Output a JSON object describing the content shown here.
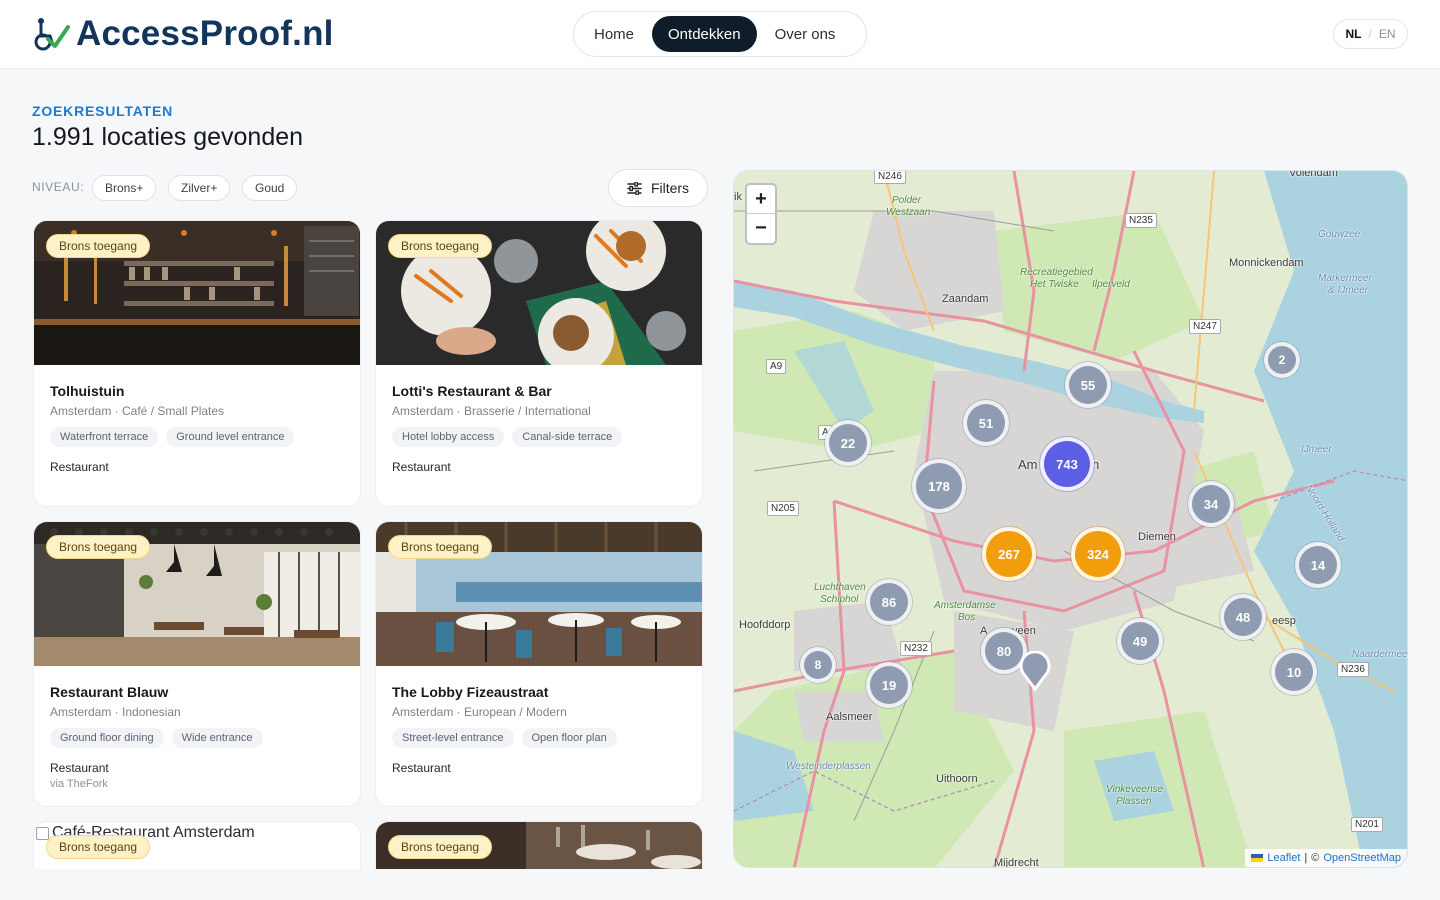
{
  "brand": {
    "name": "AccessProof.nl"
  },
  "nav": {
    "items": [
      "Home",
      "Ontdekken",
      "Over ons"
    ],
    "active": "Ontdekken"
  },
  "lang": {
    "active": "NL",
    "separator": "/",
    "other": "EN"
  },
  "results": {
    "eyebrow": "ZOEKRESULTATEN",
    "title": "1.991 locaties gevonden"
  },
  "filters": {
    "niveau_label": "NIVEAU:",
    "chips": [
      "Brons+",
      "Zilver+",
      "Goud"
    ],
    "button": "Filters"
  },
  "cards": [
    {
      "badge": "Brons toegang",
      "name": "Tolhuistuin",
      "meta": "Amsterdam · Café / Small Plates",
      "tags": [
        "Waterfront terrace",
        "Ground level entrance"
      ],
      "type": "Restaurant",
      "via": ""
    },
    {
      "badge": "Brons toegang",
      "name": "Lotti's Restaurant & Bar",
      "meta": "Amsterdam · Brasserie / International",
      "tags": [
        "Hotel lobby access",
        "Canal-side terrace"
      ],
      "type": "Restaurant",
      "via": ""
    },
    {
      "badge": "Brons toegang",
      "name": "Restaurant Blauw",
      "meta": "Amsterdam · Indonesian",
      "tags": [
        "Ground floor dining",
        "Wide entrance"
      ],
      "type": "Restaurant",
      "via": "via TheFork"
    },
    {
      "badge": "Brons toegang",
      "name": "The Lobby Fizeaustraat",
      "meta": "Amsterdam · European / Modern",
      "tags": [
        "Street-level entrance",
        "Open floor plan"
      ],
      "type": "Restaurant",
      "via": ""
    },
    {
      "badge": "Brons toegang",
      "alt": "Café-Restaurant Amsterdam"
    },
    {
      "badge": "Brons toegang"
    }
  ],
  "map": {
    "zoom_in": "+",
    "zoom_out": "−",
    "clusters": [
      "743",
      "324",
      "267",
      "178",
      "86",
      "80",
      "55",
      "51",
      "49",
      "48",
      "34",
      "22",
      "19",
      "14",
      "10",
      "8",
      "2"
    ],
    "places": {
      "zaandam": "Zaandam",
      "monnickendam": "Monnickendam",
      "diemen": "Diemen",
      "hoofddorp": "Hoofddorp",
      "aalsmeer": "Aalsmeer",
      "uithoorn": "Uithoorn",
      "mijdrecht": "Mijdrecht",
      "amsterdam_a": "Am",
      "amsterdam_b": "n",
      "amstelveen_a": "A",
      "amstelveen_b": "veen",
      "weesp": "eesp",
      "volendam": "Volendam",
      "polder": "Polder",
      "westzaan": "Westzaan",
      "recreatie": "Recreatiegebied",
      "twiske": "Het Twiske",
      "ilperveld": "Ilperveld",
      "gouwzee": "Gouwzee",
      "markermeer": "Markermeer",
      "ijmeer_sub": "& IJmeer",
      "ijmeer": "IJmeer",
      "noordholland": "Noord-Holland",
      "luchthaven": "Luchthaven",
      "schiphol": "Schiphol",
      "amsterdamse": "Amsterdamse",
      "bos": "Bos",
      "westeinder": "Westeinderplassen",
      "vinkeveense": "Vinkeveense",
      "plassen": "Plassen",
      "naarder": "Naardermeer",
      "ik": "ik"
    },
    "roads": [
      "N246",
      "N235",
      "N247",
      "A9",
      "N205",
      "N232",
      "N236",
      "N201",
      "A"
    ],
    "attribution": {
      "leaflet": "Leaflet",
      "sep": "|",
      "copy": "©",
      "osm": "OpenStreetMap"
    }
  },
  "colors": {
    "brand": "#12355b",
    "accent": "#1f7ad1",
    "badge_bg": "#fdf2c7",
    "cluster_gray": "#8f9bb0",
    "cluster_orange": "#f29d0b",
    "cluster_purple": "#5c5ee6"
  }
}
